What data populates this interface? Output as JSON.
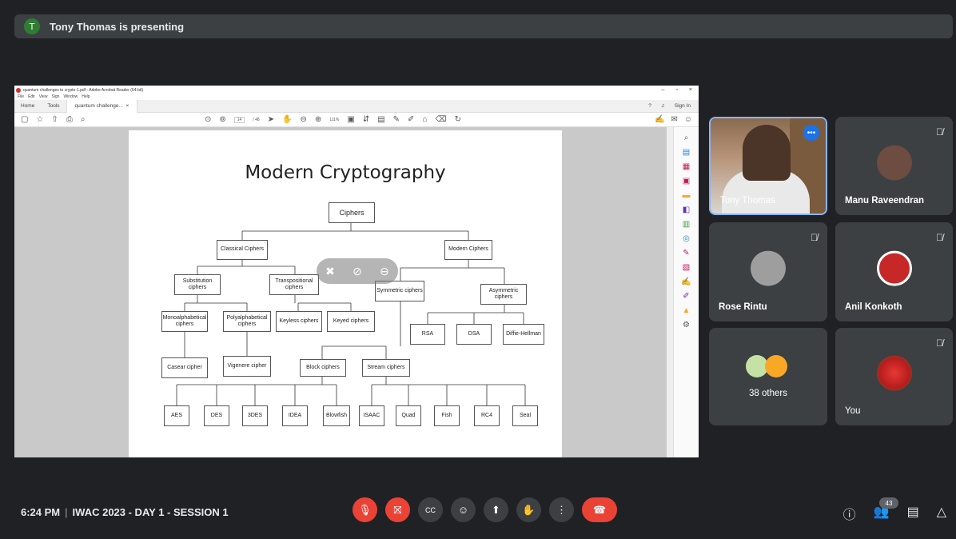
{
  "banner": {
    "avatar_letter": "T",
    "text": "Tony Thomas is presenting"
  },
  "acrobat": {
    "window_title": "quantum challenges to crypto-1.pdf - Adobe Acrobat Reader (64-bit)",
    "menu": [
      "File",
      "Edit",
      "View",
      "Sign",
      "Window",
      "Help"
    ],
    "tabs": {
      "home": "Home",
      "tools": "Tools",
      "doc": "quantum challenge...",
      "close": "×"
    },
    "sign_in": "Sign In",
    "page_current": "14",
    "page_total": "/ 48",
    "zoom": "111%"
  },
  "slide": {
    "title": "Modern Cryptography",
    "nodes": {
      "ciphers": "Ciphers",
      "classical": "Classical Ciphers",
      "modern": "Modern Ciphers",
      "substitution": "Substitution ciphers",
      "transpositional": "Transpositional ciphers",
      "symmetric": "Symmetric ciphers",
      "asymmetric": "Asymmetric ciphers",
      "mono": "Monoalphabetical ciphers",
      "poly": "Polyalphabetical ciphers",
      "keyless": "Keyless ciphers",
      "keyed": "Keyed ciphers",
      "rsa": "RSA",
      "dsa": "DSA",
      "dh": "Diffie-Hellman",
      "caesar": "Casear cipher",
      "vigenere": "Vigenere cipher",
      "block": "Block ciphers",
      "stream": "Stream ciphers",
      "aes": "AES",
      "des": "DES",
      "3des": "3DES",
      "idea": "IDEA",
      "blowfish": "Blowfish",
      "isaac": "ISAAC",
      "quad": "Quad",
      "fish": "Fish",
      "rc4": "RC4",
      "seal": "Seal"
    }
  },
  "participants": {
    "tony": "Tony Thomas",
    "manu": "Manu Raveendran",
    "rose": "Rose Rintu",
    "anil": "Anil Konkoth",
    "others": "38 others",
    "you": "You"
  },
  "bottom": {
    "time": "6:24 PM",
    "meeting": "IWAC 2023 - DAY 1 - SESSION 1",
    "participant_count": "43"
  },
  "colors": {
    "background": "#202124",
    "tile": "#3c4043",
    "red": "#ea4335",
    "accent": "#1a73e8"
  }
}
